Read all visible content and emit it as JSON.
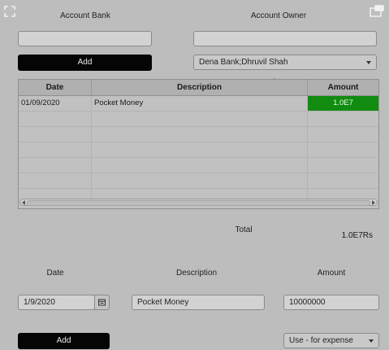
{
  "top": {
    "account_bank_label": "Account Bank",
    "account_owner_label": "Account Owner",
    "account_bank_value": "",
    "account_owner_value": "",
    "add_label": "Add",
    "account_select_value": "Dena Bank;Dhruvil Shah"
  },
  "table": {
    "columns": [
      "Date",
      "Description",
      "Amount"
    ],
    "rows": [
      {
        "date": "01/09/2020",
        "description": "Pocket Money",
        "amount": "1.0E7"
      }
    ],
    "amount_highlight_color": "#118c11"
  },
  "summary": {
    "total_label": "Total",
    "total_value": "1.0E7Rs"
  },
  "entry": {
    "date_label": "Date",
    "description_label": "Description",
    "amount_label": "Amount",
    "date_value": "1/9/2020",
    "description_value": "Pocket Money",
    "amount_value": "10000000",
    "add_label": "Add",
    "type_select_value": "Use - for expense"
  },
  "icons": {
    "top_left": "fullscreen-icon",
    "top_right": "window-icon",
    "calendar": "calendar-icon"
  }
}
